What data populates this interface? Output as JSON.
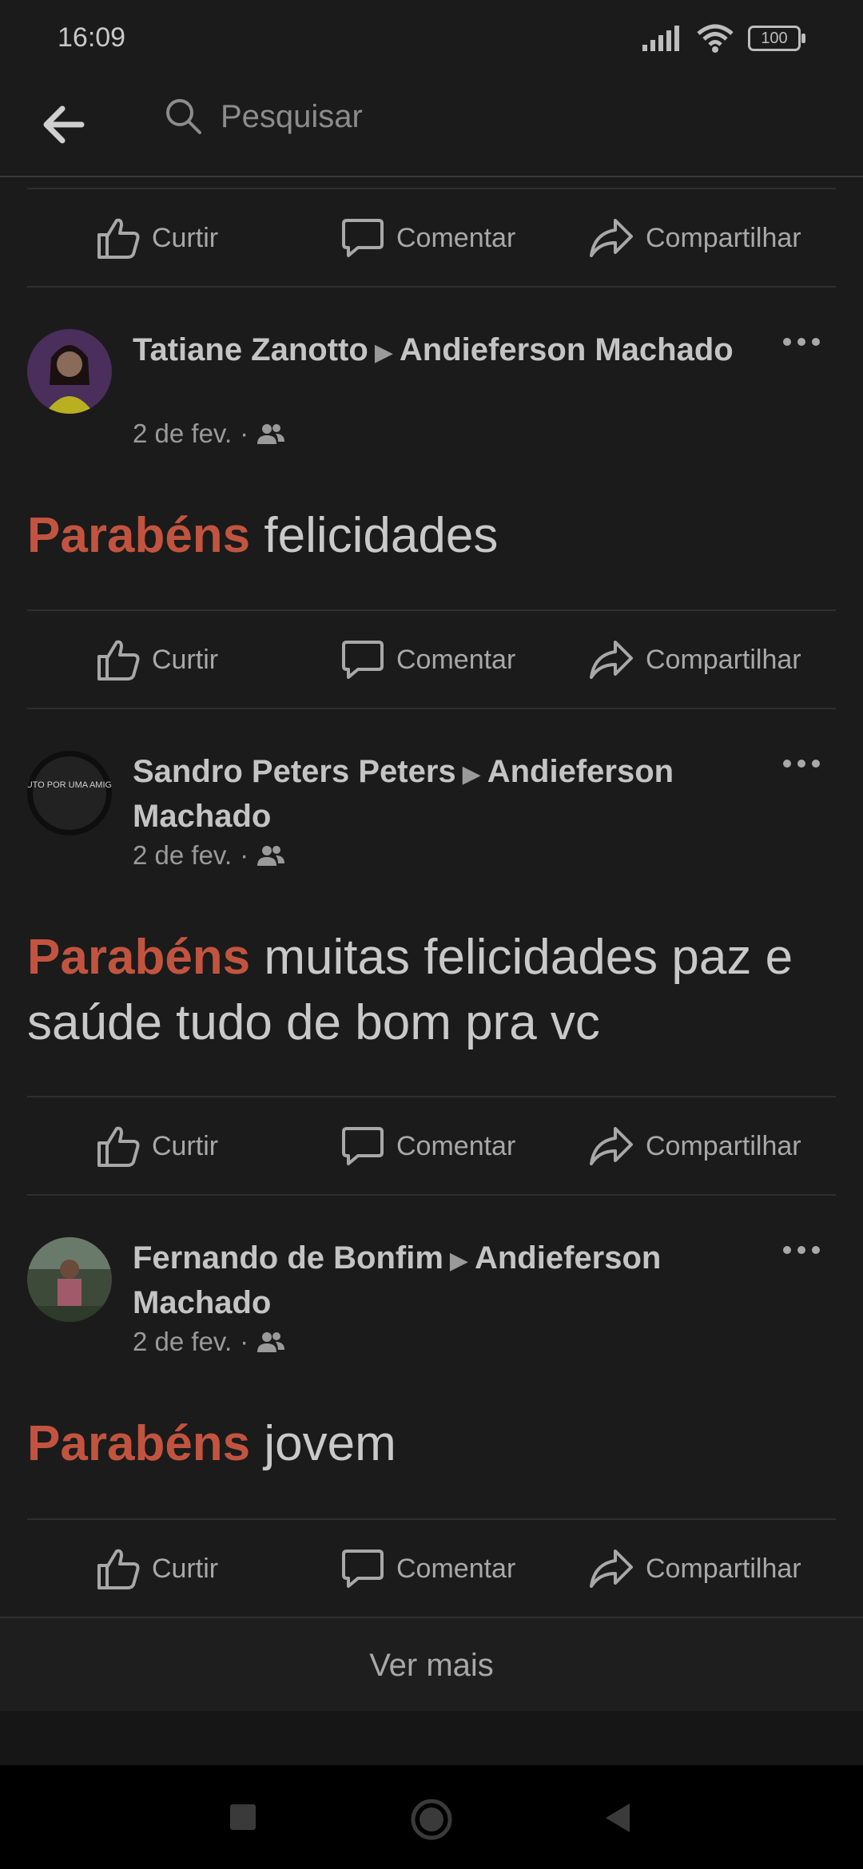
{
  "status": {
    "time": "16:09",
    "battery": "100"
  },
  "search": {
    "placeholder": "Pesquisar"
  },
  "actions": {
    "like": "Curtir",
    "comment": "Comentar",
    "share": "Compartilhar"
  },
  "posts": [
    {
      "author": "Tatiane Zanotto",
      "target": "Andieferson Machado",
      "date": "2 de fev.",
      "highlight": "Parabéns",
      "text": " felicidades"
    },
    {
      "author": "Sandro Peters Peters",
      "target": "Andieferson Machado",
      "date": "2 de fev.",
      "avatar_text": "LUTO POR UMA AMIGA",
      "highlight": "Parabéns",
      "text": " muitas felicidades paz e saúde tudo de bom pra vc"
    },
    {
      "author": "Fernando de Bonfim",
      "target": "Andieferson Machado",
      "date": "2 de fev.",
      "highlight": "Parabéns",
      "text": " jovem"
    }
  ],
  "footer": {
    "see_more": "Ver mais"
  },
  "colors": {
    "background": "#1b1b1b",
    "highlight": "#c2543f"
  }
}
